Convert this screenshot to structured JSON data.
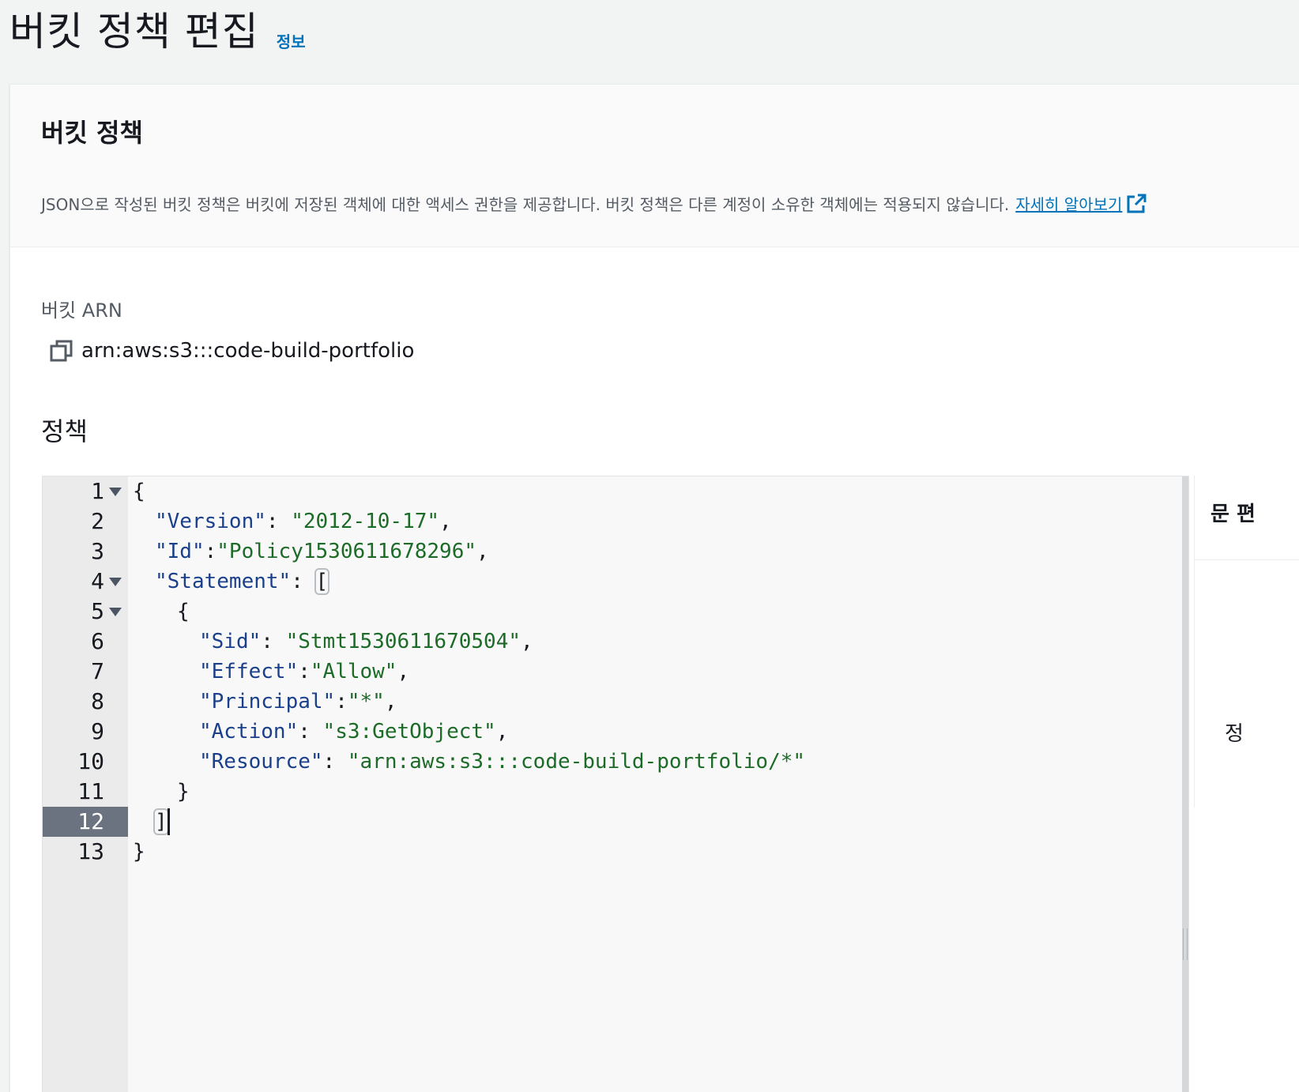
{
  "header": {
    "title": "버킷 정책 편집",
    "info_link": "정보"
  },
  "section": {
    "title": "버킷 정책",
    "description": "JSON으로 작성된 버킷 정책은 버킷에 저장된 객체에 대한 액세스 권한을 제공합니다. 버킷 정책은 다른 계정이 소유한 객체에는 적용되지 않습니다.",
    "learn_more": "자세히 알아보기",
    "external_icon": "external-link-icon"
  },
  "arn": {
    "label": "버킷 ARN",
    "value": "arn:aws:s3:::code-build-portfolio",
    "copy_icon": "copy-icon"
  },
  "policy": {
    "label": "정책"
  },
  "editor": {
    "active_line": 12,
    "line_numbers": [
      "1",
      "2",
      "3",
      "4",
      "5",
      "6",
      "7",
      "8",
      "9",
      "10",
      "11",
      "12",
      "13"
    ],
    "code": {
      "l1": "{",
      "l2_key": "\"Version\"",
      "l2_sep": ": ",
      "l2_val": "\"2012-10-17\"",
      "l2_end": ",",
      "l3_key": "\"Id\"",
      "l3_sep": ":",
      "l3_val": "\"Policy1530611678296\"",
      "l3_end": ",",
      "l4_key": "\"Statement\"",
      "l4_sep": ": ",
      "l4_bracket": "[",
      "l5": "{",
      "l6_key": "\"Sid\"",
      "l6_sep": ": ",
      "l6_val": "\"Stmt1530611670504\"",
      "l6_end": ",",
      "l7_key": "\"Effect\"",
      "l7_sep": ":",
      "l7_val": "\"Allow\"",
      "l7_end": ",",
      "l8_key": "\"Principal\"",
      "l8_sep": ":",
      "l8_val": "\"*\"",
      "l8_end": ",",
      "l9_key": "\"Action\"",
      "l9_sep": ": ",
      "l9_val": "\"s3:GetObject\"",
      "l9_end": ",",
      "l10_key": "\"Resource\"",
      "l10_sep": ": ",
      "l10_val": "\"arn:aws:s3:::code-build-portfolio/*\"",
      "l11": "}",
      "l12": "]",
      "l13": "}"
    }
  },
  "side_panel": {
    "header": "문 편",
    "text": "정"
  },
  "colors": {
    "link": "#0073bb",
    "json_key": "#1a3f8b",
    "json_string": "#1c6b27",
    "active_gutter": "#6b7280"
  }
}
